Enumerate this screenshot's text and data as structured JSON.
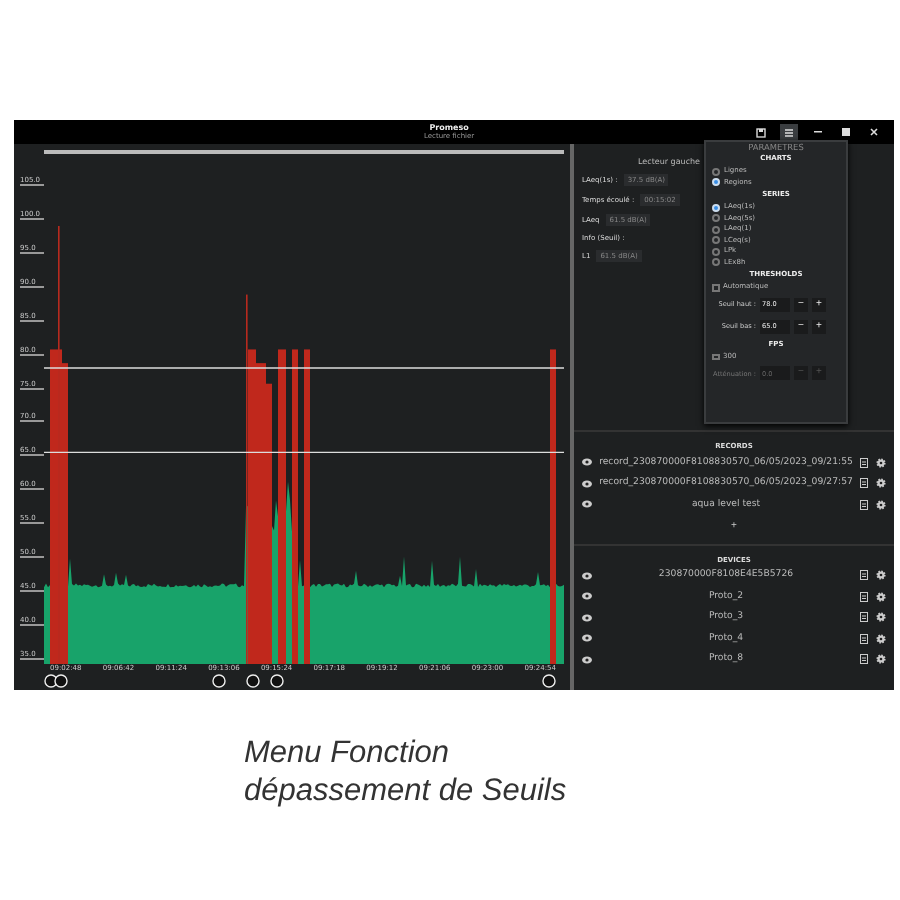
{
  "window": {
    "title": "Promeso",
    "subtitle": "Lecture fichier"
  },
  "chart": {
    "y_labels": [
      "105.0",
      "100.0",
      "95.0",
      "90.0",
      "85.0",
      "80.0",
      "75.0",
      "70.0",
      "65.0",
      "60.0",
      "55.0",
      "50.0",
      "45.0",
      "40.0",
      "35.0"
    ],
    "x_labels": [
      "09:02:48",
      "09:06:42",
      "09:11:24",
      "09:13:06",
      "09:15:24",
      "09:17:18",
      "09:19:12",
      "09:21:06",
      "09:23:00",
      "09:24:54"
    ]
  },
  "player": {
    "title": "Lecteur gauche",
    "readings": [
      {
        "label": "LAeq(1s) :",
        "value": "37.5 dB(A)"
      },
      {
        "label": "Temps écoulé :",
        "value": "00:15:02"
      },
      {
        "label": "LAeq",
        "value": "61.5 dB(A)"
      },
      {
        "label": "Info (Seuil) :"
      },
      {
        "label": "L1",
        "value": "61.5 dB(A)"
      }
    ]
  },
  "menu": {
    "title": "PARAMETRES",
    "items": [
      {
        "kind": "heading",
        "label": "CHARTS"
      },
      {
        "kind": "radio",
        "label": "Lignes",
        "selected": false
      },
      {
        "kind": "radio",
        "label": "Regions",
        "selected": true
      },
      {
        "kind": "heading",
        "label": "SERIES"
      },
      {
        "kind": "radio",
        "label": "LAeq(1s)",
        "selected": true
      },
      {
        "kind": "radio",
        "label": "LAeq(5s)",
        "selected": false
      },
      {
        "kind": "radio",
        "label": "LAeq(1)",
        "selected": false
      },
      {
        "kind": "radio",
        "label": "LCeq(s)",
        "selected": false
      },
      {
        "kind": "radio",
        "label": "LPk",
        "selected": false
      },
      {
        "kind": "radio",
        "label": "LEx8h",
        "selected": false
      },
      {
        "kind": "heading",
        "label": "THRESHOLDS"
      },
      {
        "kind": "checkbox",
        "label": "Automatique",
        "checked": false
      },
      {
        "kind": "stepper",
        "label": "Seuil haut :",
        "value": "78.0",
        "minus": "−",
        "plus": "+",
        "disabled": false
      },
      {
        "kind": "stepper",
        "label": "Seuil bas :",
        "value": "65.0",
        "minus": "−",
        "plus": "+",
        "disabled": false
      },
      {
        "kind": "heading",
        "label": "FPS"
      },
      {
        "kind": "checkbox",
        "label": "300",
        "checked": false
      },
      {
        "kind": "stepper",
        "label": "Atténuation :",
        "value": "0.0",
        "minus": "−",
        "plus": "+",
        "disabled": true
      }
    ]
  },
  "records": {
    "title": "RECORDS",
    "add": "+",
    "items": [
      {
        "name": "record_230870000F8108830570_06/05/2023_09/21:55"
      },
      {
        "name": "record_230870000F8108830570_06/05/2023_09/27:57"
      },
      {
        "name": "aqua level test"
      }
    ]
  },
  "devices": {
    "title": "DEVICES",
    "items": [
      {
        "name": "230870000F8108E4E5B5726"
      },
      {
        "name": "Proto_2"
      },
      {
        "name": "Proto_3"
      },
      {
        "name": "Proto_4"
      },
      {
        "name": "Proto_8"
      }
    ]
  },
  "caption": {
    "lines": [
      "Menu Fonction",
      "dépassement de Seuils"
    ]
  }
}
